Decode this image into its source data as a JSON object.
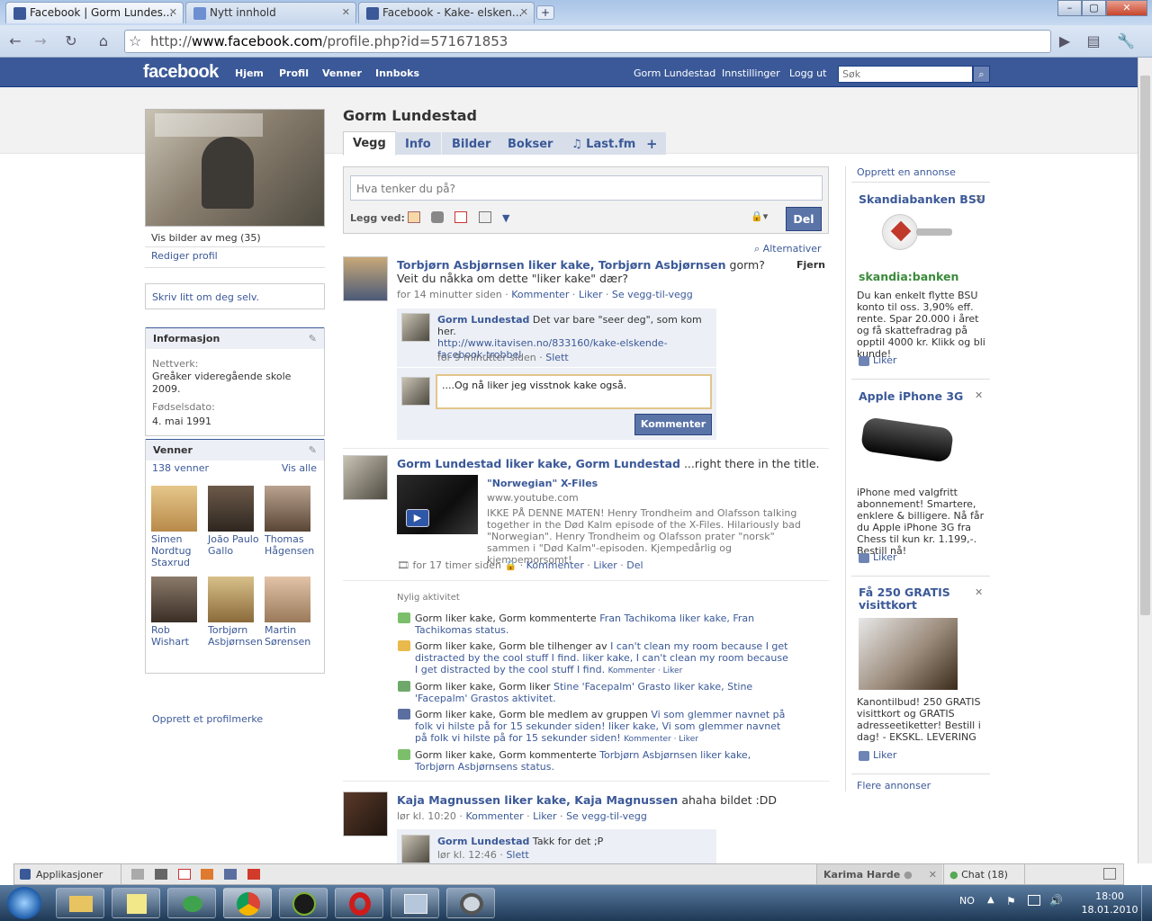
{
  "browser": {
    "tabs": [
      {
        "title": "Facebook | Gorm Lundes..."
      },
      {
        "title": "Nytt innhold"
      },
      {
        "title": "Facebook - Kake- elsken..."
      }
    ],
    "url_prefix": "http://",
    "url_host": "www.facebook.com",
    "url_path": "/profile.php?id=571671853"
  },
  "fb_header": {
    "logo": "facebook",
    "nav": [
      "Hjem",
      "Profil",
      "Venner",
      "Innboks"
    ],
    "user": "Gorm Lundestad",
    "settings": "Innstillinger",
    "logout": "Logg ut",
    "search_placeholder": "Søk"
  },
  "profile": {
    "name": "Gorm Lundestad",
    "tabs": [
      "Vegg",
      "Info",
      "Bilder",
      "Bokser",
      "♫ Last.fm",
      "+"
    ],
    "photos_link": "Vis bilder av meg (35)",
    "edit_profile": "Rediger profil",
    "about_prompt": "Skriv litt om deg selv.",
    "info": {
      "header": "Informasjon",
      "network_label": "Nettverk:",
      "network_value": "Greåker videregående skole 2009.",
      "birthday_label": "Fødselsdato:",
      "birthday_value": "4. mai 1991"
    },
    "friends": {
      "header": "Venner",
      "count": "138 venner",
      "see_all": "Vis alle",
      "list": [
        {
          "name": "Simen Nordtug Staxrud"
        },
        {
          "name": "João Paulo Gallo"
        },
        {
          "name": "Thomas Hågensen"
        },
        {
          "name": "Rob Wishart"
        },
        {
          "name": "Torbjørn Asbjørnsen"
        },
        {
          "name": "Martin Sørensen"
        }
      ]
    },
    "badge_link": "Opprett et profilmerke"
  },
  "publisher": {
    "placeholder": "Hva tenker du på?",
    "attach_label": "Legg ved:",
    "share_button": "Del"
  },
  "options_link": "Alternativer",
  "story1": {
    "title": "Torbjørn Asbjørnsen liker kake, Torbjørn Asbjørnsen",
    "text": "gorm? Veit du nåkka om dette \"liker kake\" dær?",
    "remove": "Fjern",
    "time": "for 14 minutter siden",
    "actions": [
      "Kommenter",
      "Liker",
      "Se vegg-til-vegg"
    ],
    "comment_author": "Gorm Lundestad",
    "comment_text": "Det var bare \"seer deg\", som kom her.",
    "comment_link": "http://www.itavisen.no/833160/kake-elskende-facebook-trobbel",
    "comment_time": "for 9 minutter siden",
    "comment_delete": "Slett",
    "reply_value": "....Og nå liker jeg visstnok kake også.",
    "reply_button": "Kommenter"
  },
  "story2": {
    "title": "Gorm Lundestad liker kake, Gorm Lundestad",
    "text": "...right there in the title.",
    "video_title": "\"Norwegian\" X-Files",
    "video_domain": "www.youtube.com",
    "video_desc": "IKKE PÅ DENNE MATEN! Henry Trondheim and Olafsson talking together in the Død Kalm episode of the X-Files. Hilariously bad \"Norwegian\". Henry Trondheim og Olafsson prater \"norsk\" sammen i \"Død Kalm\"-episoden. Kjempedårlig og kjempemorsomt!",
    "time": "for 17 timer siden",
    "actions": [
      "Kommenter",
      "Liker",
      "Del"
    ]
  },
  "recent": {
    "header": "Nylig aktivitet",
    "items": [
      {
        "text": "Gorm liker kake, Gorm kommenterte",
        "link": "Fran Tachikoma liker kake, Fran Tachikomas status."
      },
      {
        "text": "Gorm liker kake, Gorm ble tilhenger av",
        "link": "I can't clean my room because I get distracted by the cool stuff I find. liker kake, I can't clean my room because I get distracted by the cool stuff I find.",
        "actions": "Kommenter · Liker"
      },
      {
        "text": "Gorm liker kake, Gorm liker",
        "link": "Stine 'Facepalm' Grasto liker kake, Stine 'Facepalm' Grastos aktivitet."
      },
      {
        "text": "Gorm liker kake, Gorm ble medlem av gruppen",
        "link": "Vi som glemmer navnet på folk vi hilste på for 15 sekunder siden! liker kake, Vi som glemmer navnet på folk vi hilste på for 15 sekunder siden!",
        "actions": "Kommenter · Liker"
      },
      {
        "text": "Gorm liker kake, Gorm kommenterte",
        "link": "Torbjørn Asbjørnsen liker kake, Torbjørn Asbjørnsens status."
      }
    ]
  },
  "story3": {
    "title": "Kaja Magnussen liker kake, Kaja Magnussen",
    "text": "ahaha bildet :DD",
    "time": "lør kl. 10:20",
    "actions": [
      "Kommenter",
      "Liker",
      "Se vegg-til-vegg"
    ],
    "comment_author": "Gorm Lundestad",
    "comment_text": "Takk for det ;P",
    "comment_time": "lør kl. 12:46",
    "comment_delete": "Slett"
  },
  "ads": {
    "create": "Opprett en annonse",
    "items": [
      {
        "title": "Skandiabanken BSU",
        "brand": "skandia:banken",
        "text": "Du kan enkelt flytte BSU konto til oss. 3,90% eff. rente. Spar 20.000 i året og få skattefradrag på opptil 4000 kr. Klikk og bli kunde!",
        "like": "Liker"
      },
      {
        "title": "Apple iPhone 3G",
        "text": "iPhone med valgfritt abonnement! Smartere, enklere & billigere. Nå får du Apple iPhone 3G fra Chess til kun kr. 1.199,-. Bestill nå!",
        "like": "Liker"
      },
      {
        "title": "Få 250 GRATIS visittkort",
        "text": "Kanontilbud! 250 GRATIS visittkort og GRATIS adresseetiketter! Bestill i dag! - EKSKL. LEVERING",
        "like": "Liker"
      }
    ],
    "more": "Flere annonser"
  },
  "chatbar": {
    "apps": "Applikasjoner",
    "contact": "Karima Harde",
    "chat": "Chat (18)"
  },
  "taskbar": {
    "lang": "NO",
    "time": "18:00",
    "date": "18.01.2010"
  },
  "colors": {
    "fb_blue": "#3b5998",
    "link": "#3b5998",
    "button": "#5b74a8"
  }
}
